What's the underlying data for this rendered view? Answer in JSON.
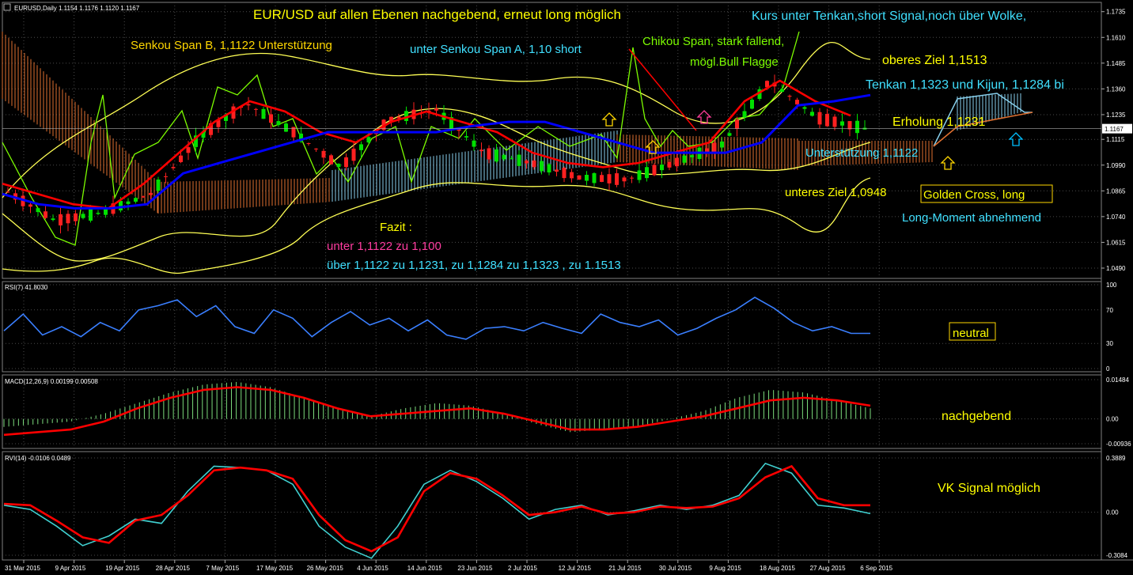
{
  "symbol_info": "EURUSD,Daily  1.1154 1.1176 1.1120 1.1167",
  "current_price": "1.1167",
  "price_axis": [
    "1.1735",
    "1.1610",
    "1.1485",
    "1.1360",
    "1.1235",
    "1.1115",
    "1.0990",
    "1.0865",
    "1.0740",
    "1.0615",
    "1.0490"
  ],
  "date_axis": [
    "31 Mar 2015",
    "9 Apr 2015",
    "19 Apr 2015",
    "28 Apr 2015",
    "7 May 2015",
    "17 May 2015",
    "26 May 2015",
    "4 Jun 2015",
    "14 Jun 2015",
    "23 Jun 2015",
    "2 Jul 2015",
    "12 Jul 2015",
    "21 Jul 2015",
    "30 Jul 2015",
    "9 Aug 2015",
    "18 Aug 2015",
    "27 Aug 2015",
    "6 Sep 2015"
  ],
  "annotations": {
    "headline": "EUR/USD auf allen Ebenen nachgebend, erneut long möglich",
    "kurs_unter": "Kurs unter  Tenkan,short Signal,noch über Wolke,",
    "senkou_b": "Senkou Span B, 1,1122 Unterstützung",
    "senkou_a": "unter Senkou Span A, 1,10 short",
    "chikou_1": "Chikou Span, stark fallend,",
    "chikou_2": "mögl.Bull Flagge",
    "oberes_ziel": "oberes Ziel 1,1513",
    "tenkan_kijun": "Tenkan 1,1323 und Kijun, 1,1284 bi",
    "erholung": "Erholung 1,1231",
    "unterstuetzung": "Unterstützung 1,1122",
    "unteres_ziel": "unteres Ziel 1,0948",
    "golden_cross": "Golden Cross, long",
    "long_moment": "Long-Moment abnehmend",
    "fazit_title": "Fazit :",
    "fazit_1": "unter 1,1122 zu 1,100",
    "fazit_2": "über 1,1122 zu 1,1231, zu 1,1284 zu 1,1323 , zu 1.1513"
  },
  "rsi": {
    "label": "RSI(7) 41.8030",
    "axis": [
      "100",
      "70",
      "30",
      "0"
    ],
    "note": "neutral"
  },
  "macd": {
    "label": "MACD(12,26,9) 0.00199 0.00508",
    "axis": [
      "0.01484",
      "0.00",
      "-0.00936"
    ],
    "note": "nachgebend"
  },
  "rvi": {
    "label": "RVI(14) -0.0106 0.0489",
    "axis": [
      "0.3889",
      "0.00",
      "-0.3084"
    ],
    "note": "VK Signal möglich"
  },
  "colors": {
    "bull": "#00e000",
    "bear": "#ff2020",
    "tenkan": "#ff0000",
    "kijun": "#0000ff",
    "bollinger": "#ffff55",
    "chikou": "#7cfc00",
    "cloud_bull": "#87ceeb",
    "cloud_bear": "#e07030",
    "rsi": "#3a7fff",
    "grid": "#4a4a4a"
  },
  "chart_data": [
    {
      "type": "candlestick",
      "title": "EURUSD,Daily",
      "ylim": [
        1.044,
        1.178
      ],
      "x": [
        "31 Mar 2015",
        "9 Apr 2015",
        "19 Apr 2015",
        "28 Apr 2015",
        "7 May 2015",
        "17 May 2015",
        "26 May 2015",
        "4 Jun 2015",
        "14 Jun 2015",
        "23 Jun 2015",
        "2 Jul 2015",
        "12 Jul 2015",
        "21 Jul 2015",
        "30 Jul 2015",
        "9 Aug 2015",
        "18 Aug 2015",
        "27 Aug 2015",
        "6 Sep 2015"
      ],
      "close": [
        1.086,
        1.072,
        1.076,
        1.085,
        1.112,
        1.129,
        1.115,
        1.098,
        1.121,
        1.126,
        1.105,
        1.1,
        1.093,
        1.092,
        1.1,
        1.109,
        1.14,
        1.122,
        1.1167
      ],
      "series": [
        {
          "name": "Tenkan",
          "values": [
            1.09,
            1.085,
            1.08,
            1.078,
            1.09,
            1.105,
            1.12,
            1.13,
            1.125,
            1.115,
            1.11,
            1.12,
            1.125,
            1.12,
            1.115,
            1.105,
            1.1,
            1.098,
            1.1,
            1.105,
            1.11,
            1.13,
            1.14,
            1.13,
            1.123
          ]
        },
        {
          "name": "Kijun",
          "values": [
            1.085,
            1.08,
            1.078,
            1.078,
            1.08,
            1.095,
            1.1,
            1.105,
            1.11,
            1.115,
            1.115,
            1.115,
            1.115,
            1.118,
            1.12,
            1.12,
            1.115,
            1.11,
            1.105,
            1.105,
            1.105,
            1.11,
            1.128,
            1.13,
            1.133
          ]
        },
        {
          "name": "Senkou Span B",
          "value": 1.1122
        },
        {
          "name": "Oberes Ziel",
          "value": 1.1513
        },
        {
          "name": "Unteres Ziel",
          "value": 1.0948
        }
      ]
    },
    {
      "type": "line",
      "title": "RSI(7) 41.8030",
      "ylim": [
        0,
        100
      ],
      "series": [
        {
          "values": [
            45,
            65,
            40,
            50,
            38,
            55,
            45,
            70,
            75,
            82,
            62,
            75,
            50,
            42,
            70,
            60,
            38,
            55,
            68,
            52,
            60,
            45,
            58,
            40,
            35,
            48,
            50,
            45,
            55,
            48,
            42,
            65,
            55,
            50,
            58,
            40,
            48,
            60,
            70,
            85,
            72,
            55,
            45,
            50,
            42,
            42
          ]
        }
      ]
    },
    {
      "type": "bar",
      "title": "MACD(12,26,9) 0.00199 0.00508",
      "ylim": [
        -0.00936,
        0.01484
      ],
      "series": [
        {
          "values": [
            -0.003,
            -0.002,
            -0.001,
            0.002,
            0.006,
            0.01,
            0.013,
            0.014,
            0.012,
            0.008,
            0.004,
            0.001,
            0.004,
            0.006,
            0.005,
            0.002,
            -0.002,
            -0.005,
            -0.004,
            -0.003,
            0.0,
            0.003,
            0.008,
            0.011,
            0.01,
            0.007,
            0.004
          ]
        },
        {
          "values": [
            -0.006,
            -0.005,
            -0.004,
            -0.001,
            0.004,
            0.008,
            0.011,
            0.012,
            0.011,
            0.008,
            0.004,
            0.001,
            0.002,
            0.003,
            0.004,
            0.002,
            -0.001,
            -0.004,
            -0.004,
            -0.003,
            -0.001,
            0.001,
            0.004,
            0.007,
            0.008,
            0.007,
            0.005
          ]
        }
      ]
    },
    {
      "type": "line",
      "title": "RVI(14) -0.0106 0.0489",
      "ylim": [
        -0.3084,
        0.3889
      ],
      "series": [
        {
          "values": [
            0.05,
            0.02,
            -0.1,
            -0.24,
            -0.17,
            -0.05,
            -0.08,
            0.15,
            0.33,
            0.32,
            0.3,
            0.2,
            -0.1,
            -0.25,
            -0.33,
            -0.1,
            0.2,
            0.3,
            0.22,
            0.1,
            -0.05,
            0.02,
            0.05,
            -0.02,
            0.01,
            0.05,
            0.02,
            0.05,
            0.12,
            0.35,
            0.28,
            0.05,
            0.03,
            -0.01
          ]
        },
        {
          "values": [
            0.06,
            0.05,
            -0.06,
            -0.18,
            -0.22,
            -0.06,
            -0.02,
            0.12,
            0.3,
            0.32,
            0.3,
            0.24,
            -0.02,
            -0.2,
            -0.28,
            -0.18,
            0.15,
            0.28,
            0.24,
            0.12,
            -0.02,
            0.0,
            0.04,
            -0.01,
            0.0,
            0.04,
            0.03,
            0.04,
            0.1,
            0.25,
            0.33,
            0.1,
            0.05,
            0.05
          ]
        }
      ]
    }
  ]
}
